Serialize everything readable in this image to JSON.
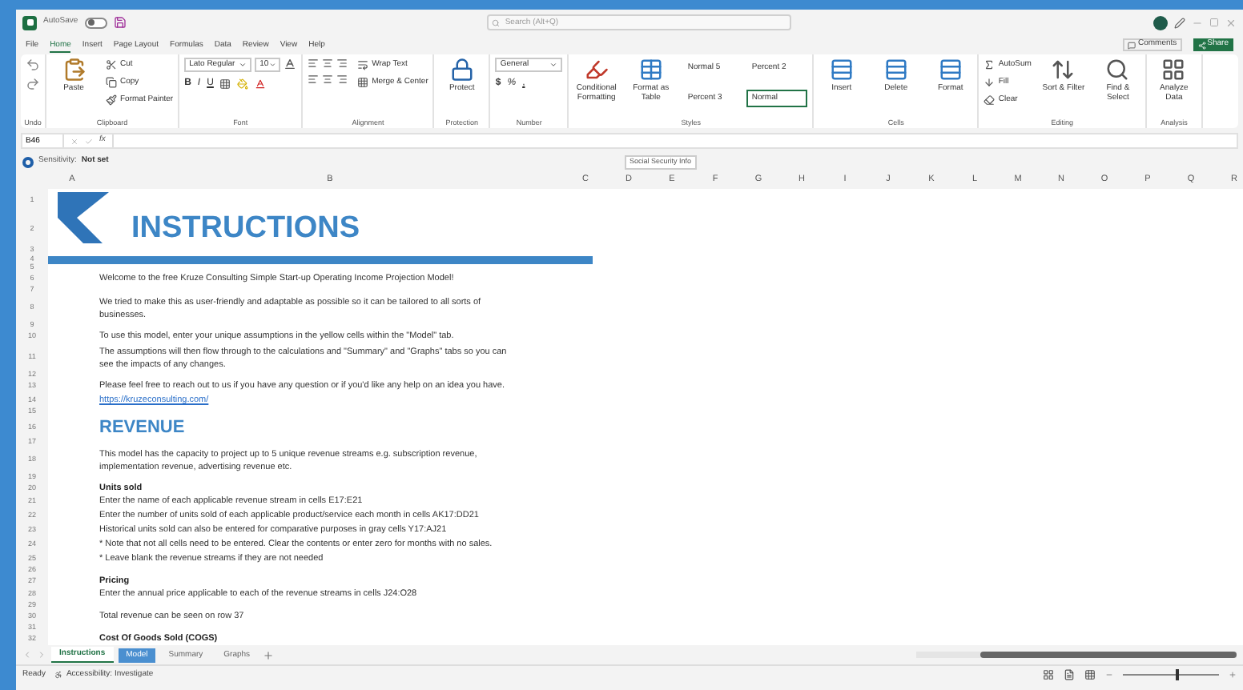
{
  "title_bar": {
    "autosave_label": "AutoSave",
    "autosave_on": false,
    "search_placeholder": "Search (Alt+Q)"
  },
  "menu": {
    "tabs": [
      {
        "label": "File",
        "selected": false
      },
      {
        "label": "Home",
        "selected": true
      },
      {
        "label": "Insert",
        "selected": false
      },
      {
        "label": "Page Layout",
        "selected": false
      },
      {
        "label": "Formulas",
        "selected": false
      },
      {
        "label": "Data",
        "selected": false
      },
      {
        "label": "Review",
        "selected": false
      },
      {
        "label": "View",
        "selected": false
      },
      {
        "label": "Help",
        "selected": false
      }
    ],
    "comments": "Comments",
    "share": "Share"
  },
  "ribbon": [
    {
      "label": "Undo",
      "items": [
        {
          "kind": "stack",
          "children": [
            {
              "kind": "icon"
            },
            {
              "kind": "icon"
            }
          ]
        }
      ]
    },
    {
      "label": "Clipboard",
      "items": [
        {
          "kind": "big",
          "label": "Paste"
        },
        {
          "kind": "stack",
          "children": [
            {
              "kind": "small",
              "label": "Cut"
            },
            {
              "kind": "small",
              "label": "Copy"
            },
            {
              "kind": "small",
              "label": "Format Painter"
            }
          ]
        }
      ]
    },
    {
      "label": "Font",
      "items": [
        {
          "kind": "stack",
          "children": [
            {
              "kind": "fields",
              "values": [
                "Lato Regular",
                "10"
              ]
            },
            {
              "kind": "chars",
              "values": [
                "B",
                "I",
                "U"
              ]
            }
          ]
        }
      ]
    },
    {
      "label": "Alignment",
      "items": [
        {
          "kind": "stack",
          "children": [
            {
              "kind": "icons"
            },
            {
              "kind": "icons"
            }
          ]
        },
        {
          "kind": "stack",
          "children": [
            {
              "kind": "small",
              "label": "Wrap Text"
            },
            {
              "kind": "small",
              "label": "Merge & Center"
            }
          ]
        }
      ]
    },
    {
      "label": "Protection",
      "items": [
        {
          "kind": "big",
          "label": "Protect"
        }
      ]
    },
    {
      "label": "Number",
      "items": [
        {
          "kind": "stack",
          "children": [
            {
              "kind": "fields",
              "values": [
                "General"
              ]
            },
            {
              "kind": "chars",
              "values": [
                "$",
                "%",
                ","
              ]
            }
          ]
        }
      ]
    },
    {
      "label": "Styles",
      "items": [
        {
          "kind": "big",
          "label": "Conditional Formatting"
        },
        {
          "kind": "big",
          "label": "Format as Table"
        },
        {
          "kind": "styles",
          "values": [
            {
              "label": "Normal 5",
              "selected": false
            },
            {
              "label": "Percent 2",
              "selected": false
            },
            {
              "label": "Percent 3",
              "selected": false
            },
            {
              "label": "Normal",
              "selected": true
            }
          ]
        }
      ]
    },
    {
      "label": "Cells",
      "items": [
        {
          "kind": "big",
          "label": "Insert"
        },
        {
          "kind": "big",
          "label": "Delete"
        },
        {
          "kind": "big",
          "label": "Format"
        }
      ]
    },
    {
      "label": "Editing",
      "items": [
        {
          "kind": "stack",
          "children": [
            {
              "kind": "small",
              "label": "AutoSum"
            },
            {
              "kind": "small",
              "label": "Fill"
            },
            {
              "kind": "small",
              "label": "Clear"
            }
          ]
        },
        {
          "kind": "big",
          "label": "Sort & Filter"
        },
        {
          "kind": "big",
          "label": "Find & Select"
        }
      ]
    },
    {
      "label": "Analysis",
      "items": [
        {
          "kind": "big",
          "label": "Analyze Data"
        }
      ]
    }
  ],
  "formula_bar": {
    "name_box": "B46",
    "fx": "fx"
  },
  "sensitivity": {
    "label": "Sensitivity:",
    "value": "Not set",
    "tag": "Social Security Info"
  },
  "columns": [
    "A",
    "B",
    "C",
    "D",
    "E",
    "F",
    "G",
    "H",
    "I",
    "J",
    "K",
    "L",
    "M",
    "N",
    "O",
    "P",
    "Q",
    "R"
  ],
  "rows": [
    {
      "n": "1",
      "kind": "logo"
    },
    {
      "n": "2",
      "kind": "title",
      "text": "INSTRUCTIONS"
    },
    {
      "n": "3",
      "kind": "gap"
    },
    {
      "n": "4",
      "kind": "bar"
    },
    {
      "n": "5",
      "kind": "gap"
    },
    {
      "n": "6",
      "kind": "text",
      "text": "Welcome to the free Kruze Consulting Simple Start-up Operating Income Projection Model!"
    },
    {
      "n": "7",
      "kind": "gap"
    },
    {
      "n": "8",
      "kind": "wrap",
      "lines": [
        "We tried to make this as user-friendly and adaptable as possible so it can be tailored to all sorts of",
        "businesses."
      ]
    },
    {
      "n": "9",
      "kind": "gap"
    },
    {
      "n": "10",
      "kind": "text",
      "text": "To use this model, enter your unique assumptions in the yellow cells within the \"Model\" tab."
    },
    {
      "n": "11",
      "kind": "wrap",
      "lines": [
        "The assumptions will then flow through to the calculations and \"Summary\" and \"Graphs\" tabs so you can",
        "see the impacts of any changes."
      ]
    },
    {
      "n": "12",
      "kind": "gap"
    },
    {
      "n": "13",
      "kind": "text",
      "text": "Please feel free to reach out to us if you have any question or if you'd like any help on an idea you have."
    },
    {
      "n": "14",
      "kind": "link",
      "text": "https://kruzeconsulting.com/"
    },
    {
      "n": "15",
      "kind": "gap"
    },
    {
      "n": "16",
      "kind": "heading",
      "text": "REVENUE"
    },
    {
      "n": "17",
      "kind": "gap"
    },
    {
      "n": "18",
      "kind": "wrap",
      "lines": [
        "This model has the capacity to project up to 5 unique revenue streams e.g. subscription revenue,",
        "implementation revenue, advertising revenue etc."
      ]
    },
    {
      "n": "19",
      "kind": "gap"
    },
    {
      "n": "20",
      "kind": "bold",
      "text": "Units sold"
    },
    {
      "n": "21",
      "kind": "text",
      "text": "Enter the name of each applicable revenue stream in cells E17:E21"
    },
    {
      "n": "22",
      "kind": "text",
      "text": "Enter the number of units sold of each applicable product/service each month in cells AK17:DD21"
    },
    {
      "n": "23",
      "kind": "text",
      "text": "Historical units sold can also be entered for comparative purposes in gray cells Y17:AJ21"
    },
    {
      "n": "24",
      "kind": "text",
      "text": "* Note that not all cells need to be entered. Clear the contents or enter zero for months with no sales."
    },
    {
      "n": "25",
      "kind": "text",
      "text": "* Leave blank the revenue streams if they are not needed"
    },
    {
      "n": "26",
      "kind": "gap"
    },
    {
      "n": "27",
      "kind": "bold",
      "text": "Pricing"
    },
    {
      "n": "28",
      "kind": "text",
      "text": "Enter the annual price applicable to each of the revenue streams in cells J24:O28"
    },
    {
      "n": "29",
      "kind": "gap"
    },
    {
      "n": "30",
      "kind": "text",
      "text": "Total revenue can be seen on row 37"
    },
    {
      "n": "31",
      "kind": "gap"
    },
    {
      "n": "32",
      "kind": "bold",
      "text": "Cost Of Goods Sold (COGS)"
    }
  ],
  "sheet_tabs": [
    {
      "label": "Instructions",
      "selected": true
    },
    {
      "label": "Model",
      "selected": false,
      "color": "#4a8fd0"
    },
    {
      "label": "Summary",
      "selected": false
    },
    {
      "label": "Graphs",
      "selected": false
    }
  ],
  "status_bar": {
    "ready": "Ready",
    "accessibility": "Accessibility: Investigate",
    "zoom": {
      "level": 0.55
    }
  }
}
